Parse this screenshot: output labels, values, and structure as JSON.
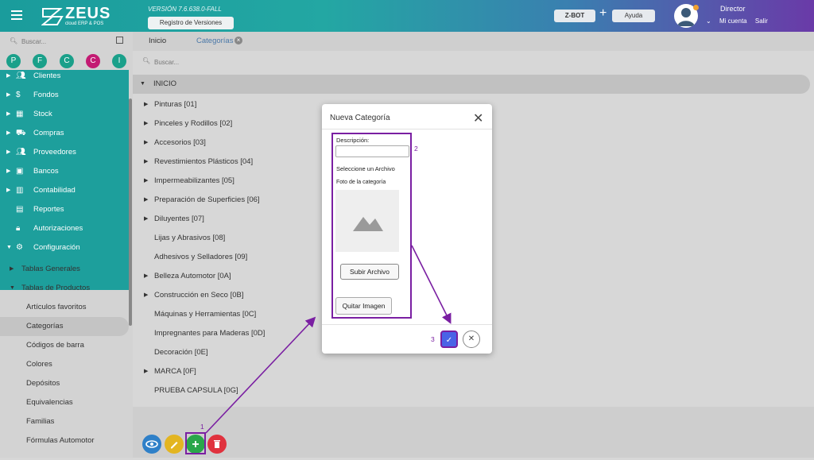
{
  "app": {
    "logo_text": "ZEUS",
    "logo_sub": "cloud ERP & POS",
    "version": "VERSIÓN 7.6.638.0-FALL",
    "registro_label": "Registro de Versiones",
    "zbot_label": "Z-BOT",
    "ayuda_label": "Ayuda",
    "user_name": "Director",
    "user_links": [
      "Mi cuenta",
      "Salir"
    ]
  },
  "sidebar": {
    "search_placeholder": "Buscar...",
    "favorites": [
      "P",
      "F",
      "C",
      "C",
      "I"
    ],
    "menu": [
      {
        "label": "Clientes",
        "icon": "people-icon"
      },
      {
        "label": "Fondos",
        "icon": "dollar-icon"
      },
      {
        "label": "Stock",
        "icon": "box-icon"
      },
      {
        "label": "Compras",
        "icon": "cart-icon"
      },
      {
        "label": "Proveedores",
        "icon": "people-icon"
      },
      {
        "label": "Bancos",
        "icon": "briefcase-icon"
      },
      {
        "label": "Contabilidad",
        "icon": "book-icon"
      },
      {
        "label": "Reportes",
        "icon": "report-icon"
      },
      {
        "label": "Autorizaciones",
        "icon": "lock-icon"
      },
      {
        "label": "Configuración",
        "icon": "gears-icon"
      }
    ],
    "submenu": [
      "Tablas Generales",
      "Tablas de Productos",
      "Artículos favoritos",
      "Categorías",
      "Códigos de barra",
      "Colores",
      "Depósitos",
      "Equivalencias",
      "Familias",
      "Fórmulas Automotor"
    ]
  },
  "tabs": [
    "Inicio",
    "Categorías"
  ],
  "main": {
    "search_placeholder": "Buscar...",
    "root": "INICIO",
    "categories": [
      "Pinturas [01]",
      "Pinceles y Rodillos [02]",
      "Accesorios [03]",
      "Revestimientos Plásticos [04]",
      "Impermeabilizantes [05]",
      "Preparación de Superficies [06]",
      "Diluyentes [07]",
      "Lijas y Abrasivos [08]",
      "Adhesivos y Selladores [09]",
      "Belleza Automotor [0A]",
      "Construcción en Seco [0B]",
      "Máquinas y Herramientas [0C]",
      "Impregnantes para Maderas [0D]",
      "Decoración [0E]",
      "MARCA [0F]",
      "PRUEBA CAPSULA [0G]"
    ]
  },
  "modal": {
    "title": "Nueva Categoría",
    "desc_label": "Descripción:",
    "desc_value": "",
    "select_label": "Seleccione un Archivo",
    "photo_label": "Foto de la categoría",
    "upload_label": "Subir Archivo",
    "remove_label": "Quitar Imagen"
  },
  "annotations": {
    "step1": "1",
    "step2": "2",
    "step3": "3",
    "color": "#7a1fa2"
  }
}
